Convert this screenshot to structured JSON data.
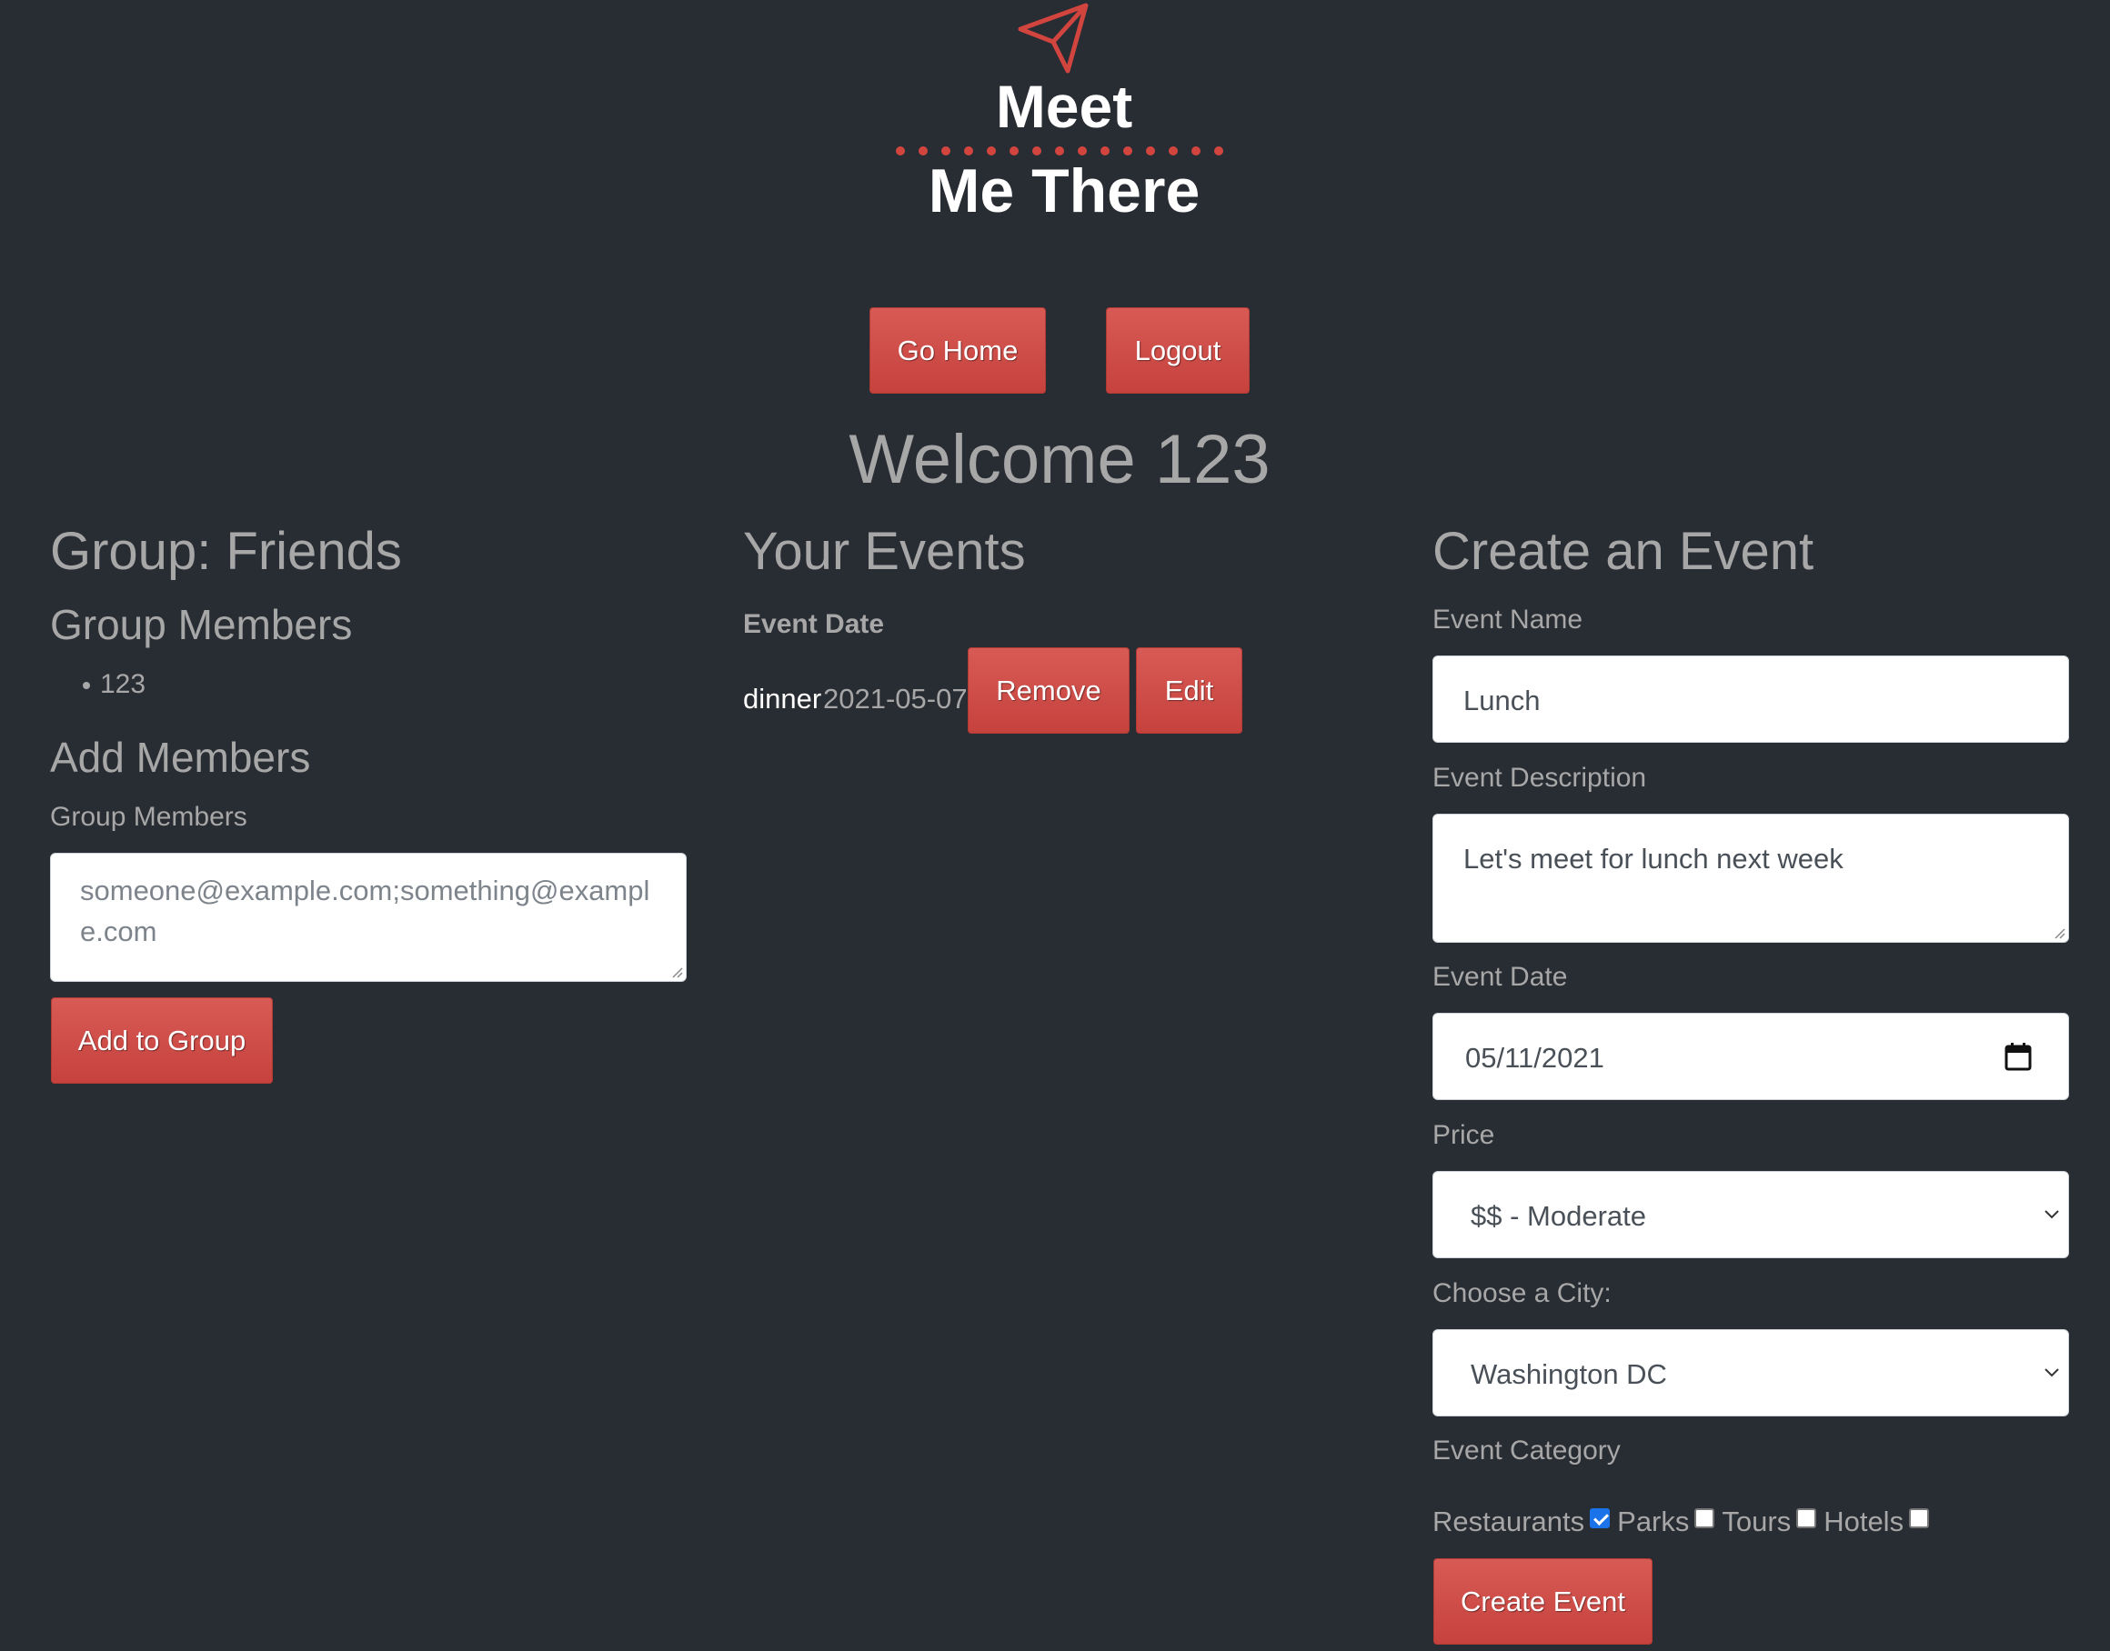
{
  "logo": {
    "line1": "Meet",
    "line2": "Me There",
    "icon": "paper-plane-icon"
  },
  "nav": {
    "home_label": "Go Home",
    "logout_label": "Logout"
  },
  "welcome": "Welcome 123",
  "group": {
    "title": "Group: Friends",
    "members_heading": "Group Members",
    "members": [
      "123"
    ],
    "add_heading": "Add Members",
    "add_label": "Group Members",
    "add_placeholder": "someone@example.com;something@example.com",
    "add_button": "Add to Group"
  },
  "events": {
    "title": "Your Events",
    "column_label": "Event Date",
    "items": [
      {
        "name": "dinner",
        "date": "2021-05-07",
        "remove_label": "Remove",
        "edit_label": "Edit"
      }
    ]
  },
  "create": {
    "title": "Create an Event",
    "name_label": "Event Name",
    "name_value": "Lunch",
    "desc_label": "Event Description",
    "desc_value": "Let's meet for lunch next week",
    "date_label": "Event Date",
    "date_value": "05/11/2021",
    "price_label": "Price",
    "price_value": "$$ - Moderate",
    "city_label": "Choose a City:",
    "city_value": "Washington DC",
    "category_label": "Event Category",
    "categories": [
      {
        "label": "Restaurants",
        "checked": true
      },
      {
        "label": "Parks",
        "checked": false
      },
      {
        "label": "Tours",
        "checked": false
      },
      {
        "label": "Hotels",
        "checked": false
      }
    ],
    "submit_label": "Create Event"
  },
  "colors": {
    "background": "#282c33",
    "accent": "#d2453f",
    "text": "#a7a7a7"
  }
}
